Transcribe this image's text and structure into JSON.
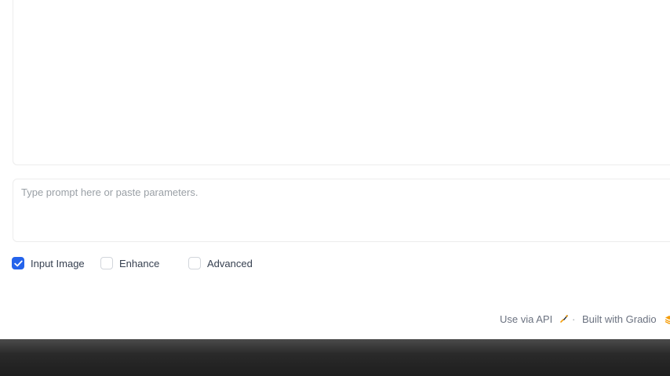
{
  "prompt": {
    "placeholder": "Type prompt here or paste parameters."
  },
  "options": [
    {
      "label": "Input Image",
      "checked": true
    },
    {
      "label": "Enhance",
      "checked": false
    },
    {
      "label": "Advanced",
      "checked": false
    }
  ],
  "footer": {
    "api_label": "Use via API",
    "separator": "·",
    "built_label": "Built with Gradio"
  },
  "colors": {
    "accent": "#2463eb",
    "footer_icon": "#f59e0b"
  }
}
